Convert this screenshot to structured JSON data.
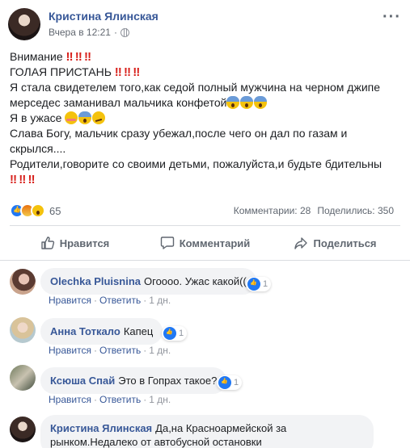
{
  "post": {
    "author": "Кристина Ялинская",
    "time": "Вчера в 12:21",
    "more": "···",
    "lines": [
      {
        "text": "Внимание ",
        "suffix": "‼️‼️‼️"
      },
      {
        "text": "ГОЛАЯ ПРИСТАНЬ ",
        "suffix": "‼️‼️‼️"
      },
      {
        "text": "Я стала свидетелем того,как седой полный мужчина на черном джипе"
      },
      {
        "text": "мерседес заманивал мальчика конфетой"
      },
      {
        "text": "Я в ужасе"
      },
      {
        "text": "Слава Богу, мальчик сразу убежал,после чего он дал по газам и"
      },
      {
        "text": "скрылся...."
      },
      {
        "text": "Родители,говорите со своими детьми, пожалуйста,и будьте бдительны"
      },
      {
        "text": "",
        "suffix": "‼️‼️‼️"
      }
    ],
    "bang": "!!",
    "reactions_count": "65",
    "comments_label": "Комментарии: 28",
    "shares_label": "Поделились: 350"
  },
  "actions": {
    "like": "Нравится",
    "comment": "Комментарий",
    "share": "Поделиться"
  },
  "comments": [
    {
      "name": "Olechka Pluisnina",
      "text": "Огоооо. Ужас какой((",
      "likes": "1",
      "like_link": "Нравится",
      "reply_link": "Ответить",
      "time": "1 дн."
    },
    {
      "name": "Анна Тоткало",
      "text": "Капец",
      "likes": "1",
      "like_link": "Нравится",
      "reply_link": "Ответить",
      "time": "1 дн."
    },
    {
      "name": "Ксюша Спай",
      "text": "Это в Гопрах такое?",
      "likes": "1",
      "like_link": "Нравится",
      "reply_link": "Ответить",
      "time": "1 дн."
    },
    {
      "name": "Кристина Ялинская",
      "text": "Да,на Красноармейской за",
      "text2": "рынком.Недалеко от автобусной остановки"
    }
  ],
  "colors": {
    "link": "#385898",
    "muted": "#606770",
    "bubble": "#f2f3f5",
    "bang": "#d8221d",
    "like_blue": "#2078f4"
  }
}
